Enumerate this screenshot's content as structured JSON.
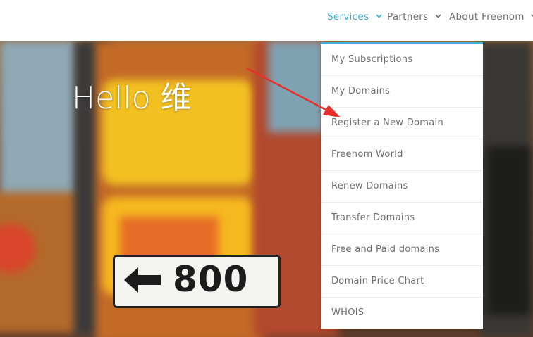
{
  "nav": {
    "items": [
      {
        "label": "Services",
        "active": true
      },
      {
        "label": "Partners",
        "active": false
      },
      {
        "label": "About Freenom",
        "active": false
      }
    ]
  },
  "hero": {
    "title": "Hello 维",
    "sign_number": "800"
  },
  "dropdown": {
    "items": [
      "My Subscriptions",
      "My Domains",
      "Register a New Domain",
      "Freenom World",
      "Renew Domains",
      "Transfer Domains",
      "Free and Paid domains",
      "Domain Price Chart",
      "WHOIS"
    ]
  },
  "colors": {
    "accent": "#3fb1d6",
    "nav_text": "#6f6f6f",
    "annotation_arrow": "#e8302a"
  },
  "icons": {
    "chevron": "chevron-down-icon",
    "annotation": "red-arrow-annotation"
  }
}
